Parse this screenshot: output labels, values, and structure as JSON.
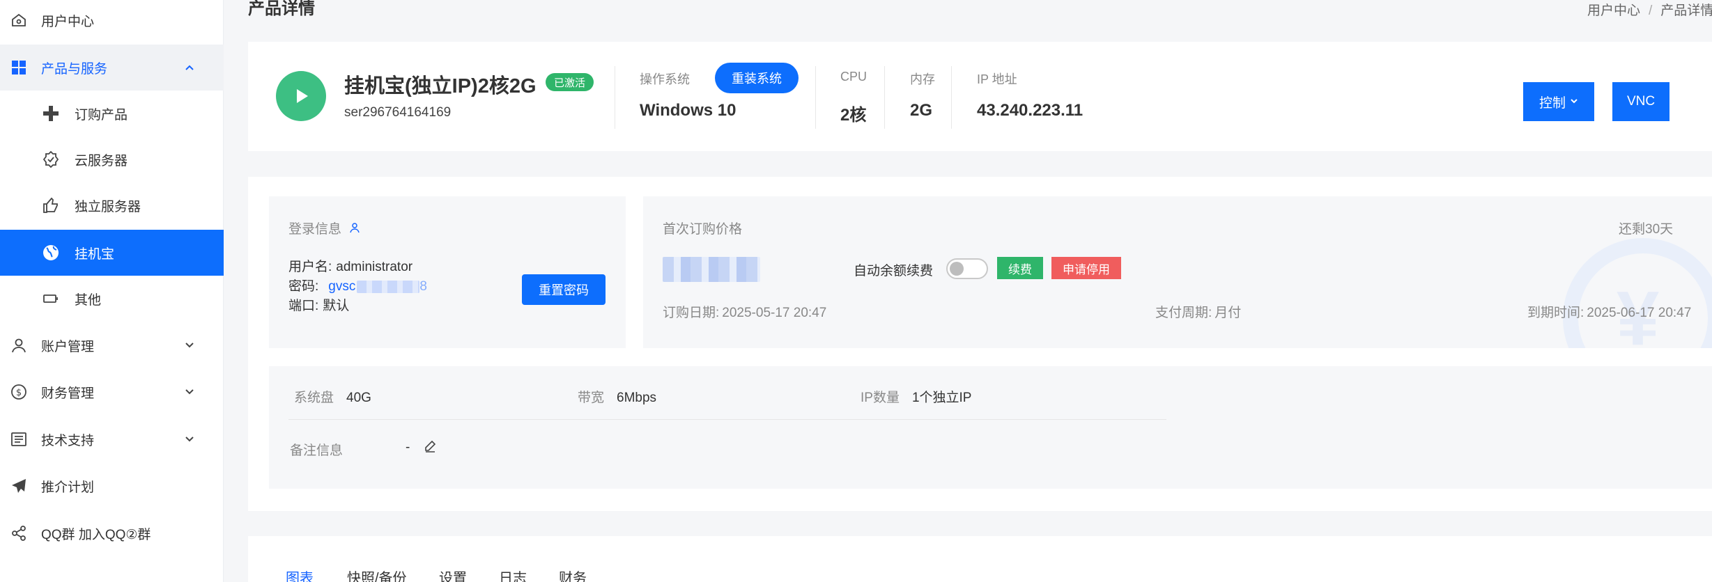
{
  "page": {
    "title": "产品详情"
  },
  "breadcrumb": {
    "home": "用户中心",
    "sep": "/",
    "current": "产品详情"
  },
  "sidebar": {
    "items": [
      {
        "label": "用户中心"
      },
      {
        "label": "产品与服务"
      },
      {
        "label": "订购产品"
      },
      {
        "label": "云服务器"
      },
      {
        "label": "独立服务器"
      },
      {
        "label": "挂机宝"
      },
      {
        "label": "其他"
      },
      {
        "label": "账户管理"
      },
      {
        "label": "财务管理"
      },
      {
        "label": "技术支持"
      },
      {
        "label": "推介计划"
      },
      {
        "label": "QQ群 加入QQ②群"
      }
    ]
  },
  "product": {
    "name": "挂机宝(独立IP)2核2G",
    "status": "已激活",
    "id": "ser296764164169",
    "os_label": "操作系统",
    "os_value": "Windows 10",
    "reinstall_label": "重装系统",
    "cpu_label": "CPU",
    "cpu_value": "2核",
    "mem_label": "内存",
    "mem_value": "2G",
    "ip_label": "IP 地址",
    "ip_value": "43.240.223.11",
    "control_label": "控制",
    "vnc_label": "VNC"
  },
  "login": {
    "title": "登录信息",
    "username_label": "用户名:",
    "username_value": "administrator",
    "password_label": "密码:",
    "password_value": "gvsc",
    "password_tail": "8",
    "port_label": "端口:",
    "port_value": "默认",
    "reset_label": "重置密码"
  },
  "billing": {
    "title": "首次订购价格",
    "remaining": "还剩30天",
    "auto_renew_label": "自动余额续费",
    "auto_renew_on": false,
    "renew_label": "续费",
    "stop_label": "申请停用",
    "order_date_label": "订购日期:",
    "order_date": "2025-05-17 20:47",
    "cycle_label": "支付周期:",
    "cycle_value": "月付",
    "expire_label": "到期时间:",
    "expire_date": "2025-06-17 20:47"
  },
  "specs": {
    "disk_label": "系统盘",
    "disk_value": "40G",
    "bw_label": "带宽",
    "bw_value": "6Mbps",
    "ipcount_label": "IP数量",
    "ipcount_value": "1个独立IP",
    "note_label": "备注信息",
    "note_value": "-"
  },
  "tabs": [
    {
      "label": "图表"
    },
    {
      "label": "快照/备份"
    },
    {
      "label": "设置"
    },
    {
      "label": "日志"
    },
    {
      "label": "财务"
    }
  ],
  "colors": {
    "primary": "#0d6efd",
    "success": "#2fb56a",
    "danger": "#f05d5d",
    "status": "#3dbf83"
  }
}
